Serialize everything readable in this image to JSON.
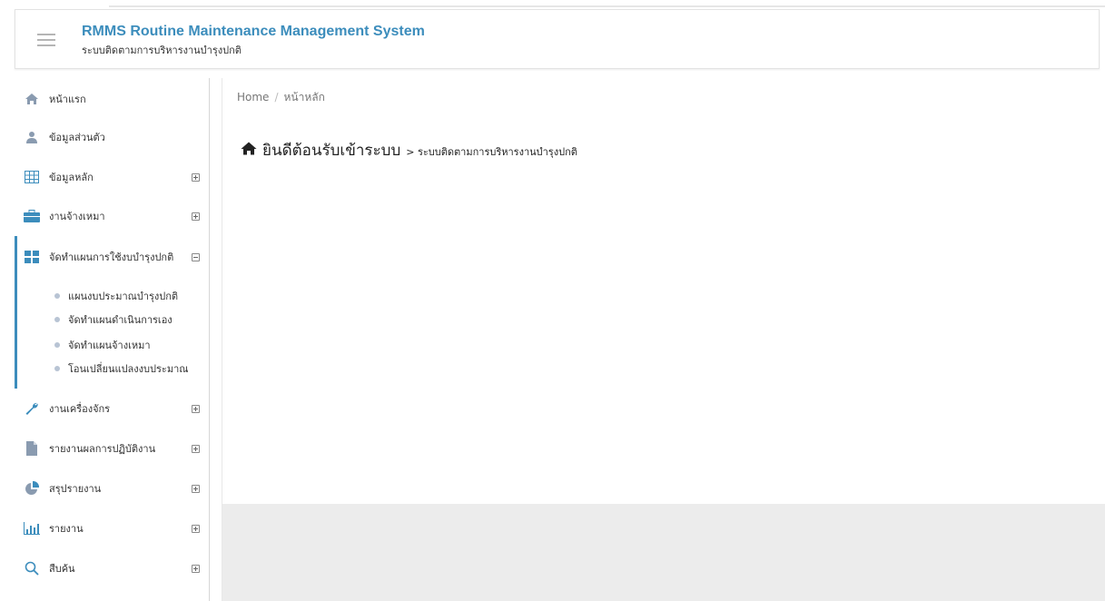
{
  "header": {
    "title": "RMMS Routine Maintenance Management System",
    "subtitle": "ระบบติดตามการบริหารงานบำรุงปกติ"
  },
  "sidebar": {
    "items": [
      {
        "label": "หน้าแรก",
        "icon": "home-icon"
      },
      {
        "label": "ข้อมูลส่วนตัว",
        "icon": "user-icon"
      },
      {
        "label": "ข้อมูลหลัก",
        "icon": "table-icon"
      },
      {
        "label": "งานจ้างเหมา",
        "icon": "briefcase-icon"
      },
      {
        "label": "จัดทำแผนการใช้งบบำรุงปกติ",
        "icon": "grid-icon"
      },
      {
        "label": "งานเครื่องจักร",
        "icon": "wrench-icon"
      },
      {
        "label": "รายงานผลการปฏิบัติงาน",
        "icon": "file-icon"
      },
      {
        "label": "สรุปรายงาน",
        "icon": "pie-chart-icon"
      },
      {
        "label": "รายงาน",
        "icon": "bar-chart-icon"
      },
      {
        "label": "สืบค้น",
        "icon": "search-icon"
      }
    ],
    "subitems": [
      {
        "label": "แผนงบประมาณบำรุงปกติ"
      },
      {
        "label": "จัดทำแผนดำเนินการเอง"
      },
      {
        "label": "จัดทำแผนจ้างเหมา"
      },
      {
        "label": "โอนเปลี่ยนแปลงงบประมาณ"
      }
    ]
  },
  "breadcrumb": {
    "home": "Home",
    "sep": "/",
    "current": "หน้าหลัก"
  },
  "page": {
    "title": "ยินดีต้อนรับเข้าระบบ",
    "subtitle": "> ระบบติดตามการบริหารงานบำรุงปกติ"
  },
  "colors": {
    "accent": "#3c8dbc",
    "icon": "#8a9bb0"
  }
}
